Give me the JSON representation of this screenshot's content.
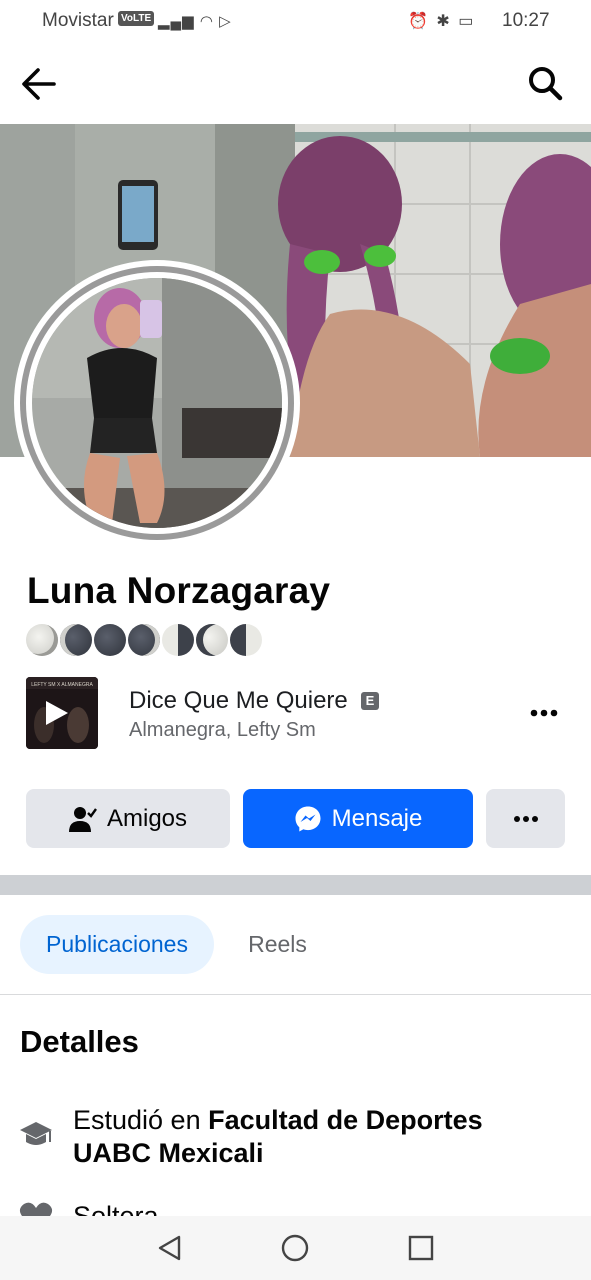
{
  "status_bar": {
    "carrier": "Movistar",
    "volte": "VoLTE",
    "time": "10:27"
  },
  "profile": {
    "name": "Luna Norzagaray",
    "moon_phases": [
      "waning-crescent",
      "new-moon",
      "new-moon",
      "new-moon",
      "first-quarter",
      "waxing-crescent",
      "last-quarter"
    ]
  },
  "music": {
    "title": "Dice Que Me Quiere",
    "explicit_badge": "E",
    "artist": "Almanegra, Lefty Sm"
  },
  "actions": {
    "friends_label": "Amigos",
    "message_label": "Mensaje"
  },
  "tabs": [
    {
      "label": "Publicaciones",
      "active": true
    },
    {
      "label": "Reels",
      "active": false
    }
  ],
  "details": {
    "heading": "Detalles",
    "education_prefix": "Estudió en ",
    "education_place": "Facultad de Deportes UABC Mexicali",
    "relationship": "Soltera"
  },
  "colors": {
    "accent": "#0866ff",
    "tab_active_bg": "#e7f3ff",
    "tab_active_text": "#0064d1",
    "button_gray": "#e4e6eb"
  },
  "icons": {
    "back": "arrow-left-icon",
    "search": "search-icon",
    "friends": "person-check-icon",
    "messenger": "messenger-icon",
    "more": "more-horizontal-icon",
    "education": "graduation-cap-icon",
    "relationship": "heart-icon"
  }
}
